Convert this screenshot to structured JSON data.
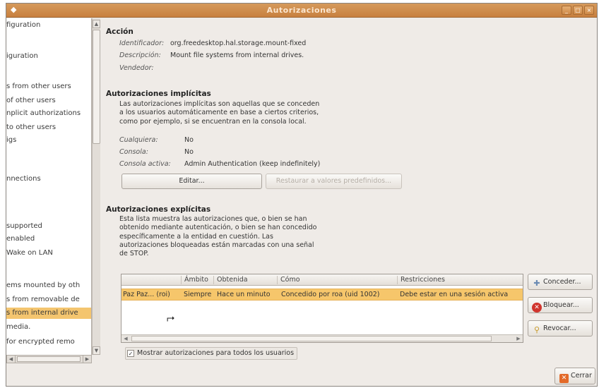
{
  "window": {
    "title": "Autorizaciones",
    "controls": [
      "_",
      "□",
      "×"
    ]
  },
  "tree": {
    "items": [
      "figuration",
      "iguration",
      "s from other users",
      "of other users",
      "nplicit authorizations",
      "to other users",
      "igs",
      "nnections",
      "supported",
      "enabled",
      "Wake on LAN",
      "ems mounted by oth",
      "s from removable de",
      "s from internal drive",
      "media.",
      "for encrypted remo"
    ],
    "selected_index": 13
  },
  "action": {
    "heading": "Acción",
    "id_label": "Identificador:",
    "id_value": "org.freedesktop.hal.storage.mount-fixed",
    "desc_label": "Descripción:",
    "desc_value": "Mount file systems from internal drives.",
    "vendor_label": "Vendedor:",
    "vendor_value": ""
  },
  "implicit": {
    "heading": "Autorizaciones implícitas",
    "description": [
      "Las autorizaciones implícitas son aquellas que se conceden",
      "a los usuarios automáticamente en base a ciertos criterios,",
      "como por ejemplo, si se encuentran en la consola local."
    ],
    "any_label": "Cualquiera:",
    "any_value": "No",
    "console_label": "Consola:",
    "console_value": "No",
    "active_label": "Consola activa:",
    "active_value": "Admin Authentication (keep indefinitely)",
    "edit_button": "Editar...",
    "restore_button": "Restaurar a valores predefinidos..."
  },
  "explicit": {
    "heading": "Autorizaciones explícitas",
    "description": [
      "Esta lista muestra las autorizaciones que, o bien se han",
      "obtenido mediante autenticación, o bien se han concedido",
      "específicamente a la entidad en cuestión. Las",
      "autorizaciones bloqueadas están marcadas con una señal",
      "de STOP."
    ],
    "columns": [
      "Ámbito",
      "Obtenida",
      "Cómo",
      "Restricciones"
    ],
    "rows": [
      {
        "entity": "Paz Paz... (roi)",
        "scope": "Siempre",
        "obtained": "Hace un minuto",
        "how": "Concedido por roa (uid 1002)",
        "restrictions": "Debe estar en una sesión activa"
      }
    ],
    "grant_button": "Conceder...",
    "block_button": "Bloquear...",
    "revoke_button": "Revocar...",
    "show_all_checkbox": "Mostrar autorizaciones para todos los usuarios",
    "show_all_checked": true
  },
  "close_button": "Cerrar"
}
